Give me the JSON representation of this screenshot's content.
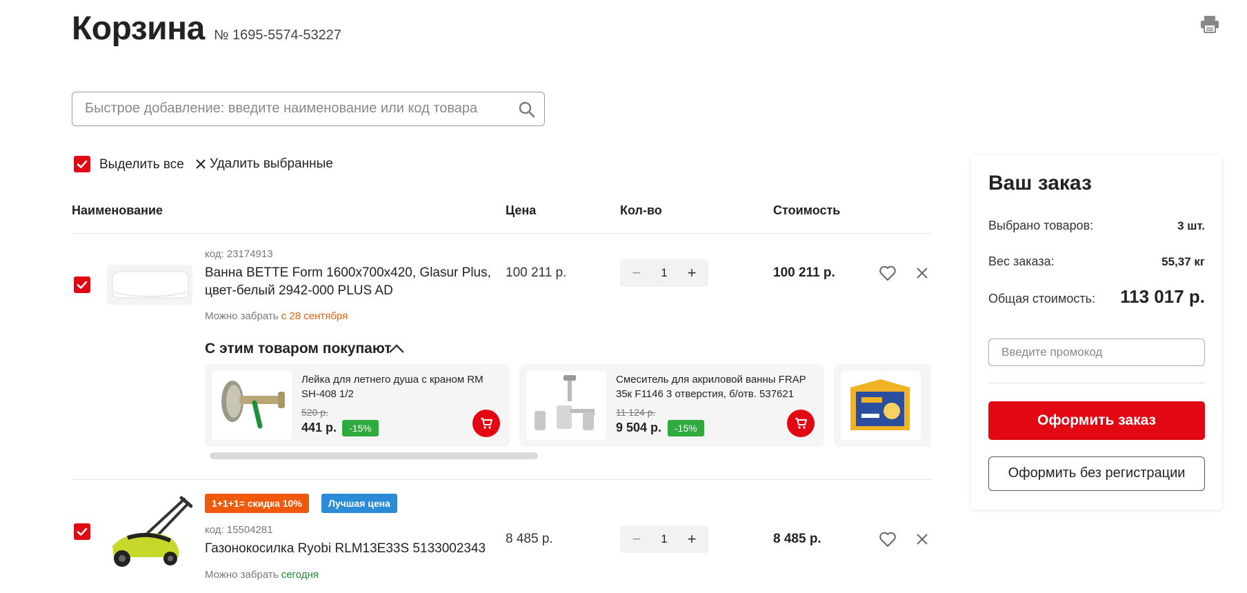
{
  "header": {
    "title": "Корзина",
    "order_number": "№ 1695-5574-53227",
    "print_icon": "printer-icon"
  },
  "search": {
    "placeholder": "Быстрое добавление: введите наименование или код товара",
    "value": "",
    "icon": "search-icon"
  },
  "bulk": {
    "select_all_label": "Выделить все",
    "select_all_checked": true,
    "delete_selected_label": "Удалить выбранные"
  },
  "table": {
    "headers": [
      "Наименование",
      "Цена",
      "Кол-во",
      "Стоимость"
    ]
  },
  "items": [
    {
      "checked": true,
      "badges": [],
      "code": "код: 23174913",
      "name_line1": "Ванна BETTE Form 1600х700х420, Glasur Plus,",
      "name_line2": "цвет-белый 2942-000 PLUS AD",
      "pickup_prefix": "Можно забрать",
      "pickup_date": "с 28 сентября",
      "price": "100 211 р.",
      "qty": "1",
      "cost": "100 211 р."
    },
    {
      "checked": true,
      "badges": [
        "1+1+1= скидка 10%",
        "Лучшая цена"
      ],
      "code": "код: 15504281",
      "name_line1": "Газонокосилка Ryobi RLM13E33S 5133002343",
      "name_line2": "",
      "pickup_prefix": "Можно забрать",
      "pickup_date": "сегодня",
      "price": "8 485 р.",
      "qty": "1",
      "cost": "8 485 р."
    }
  ],
  "also_bought": {
    "title": "С этим товаром покупают",
    "products": [
      {
        "name": "Лейка для летнего душа с краном RM SH-408 1/2",
        "old_price": "520 р.",
        "price": "441 р.",
        "discount": "-15%"
      },
      {
        "name": "Смеситель для акриловой ванны FRAP 35к F1146 3 отверстия, б/отв. 537621",
        "old_price": "11 124 р.",
        "price": "9 504 р.",
        "discount": "-15%"
      }
    ]
  },
  "summary": {
    "title": "Ваш заказ",
    "items_label": "Выбрано товаров:",
    "items_value": "3 шт.",
    "weight_label": "Вес заказа:",
    "weight_value": "55,37 кг",
    "total_label": "Общая стоимость:",
    "total_value": "113 017 р.",
    "promo_placeholder": "Введите промокод",
    "order_button": "Оформить заказ",
    "guest_button": "Оформить без регистрации"
  },
  "colors": {
    "brand_red": "#e30613",
    "discount_green": "#2eaa3f",
    "badge_orange": "#ef5a0a",
    "badge_blue": "#2a8bd8",
    "date_orange": "#e5600f",
    "date_green": "#1a8f2b"
  }
}
